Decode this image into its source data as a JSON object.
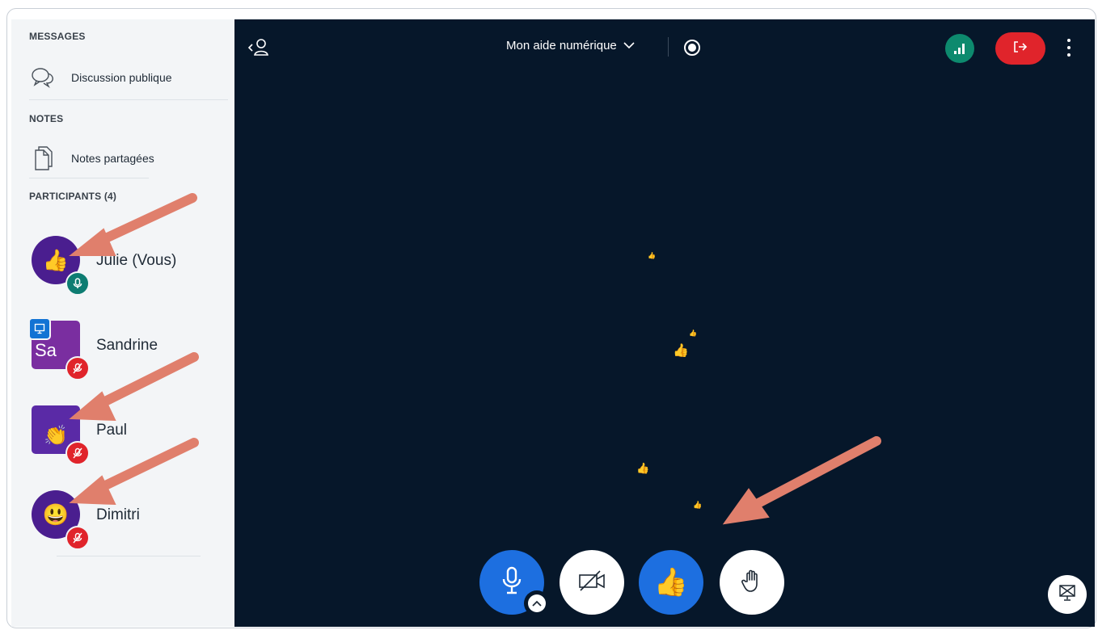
{
  "sidebar": {
    "messages_title": "MESSAGES",
    "public_chat_label": "Discussion publique",
    "notes_title": "NOTES",
    "shared_notes_label": "Notes partagées",
    "participants_title": "PARTICIPANTS (4)",
    "participants": [
      {
        "name": "Julie (Vous)",
        "avatar_emoji": "👍",
        "avatar_color": "#4a1e8f",
        "shape": "round",
        "mic_state": "unmuted",
        "mic_color": "#0d7c72"
      },
      {
        "name": "Sandrine",
        "avatar_text": "Sa",
        "avatar_color": "#7a2ea0",
        "shape": "square",
        "presenter": true,
        "mic_state": "muted",
        "mic_color": "#e0242b"
      },
      {
        "name": "Paul",
        "avatar_emoji": "👏",
        "avatar_color": "#5a2aa6",
        "shape": "square",
        "mic_state": "muted",
        "mic_color": "#e0242b"
      },
      {
        "name": "Dimitri",
        "avatar_emoji": "😃",
        "avatar_color": "#4a1e8f",
        "shape": "round",
        "mic_state": "muted",
        "mic_color": "#e0242b"
      }
    ]
  },
  "topbar": {
    "meeting_title": "Mon aide numérique",
    "icons": [
      "user-list-toggle-icon",
      "chevron-down-icon",
      "record-icon",
      "connection-status-icon",
      "leave-meeting-icon",
      "more-options-icon"
    ],
    "connection_color": "#0d8a6e",
    "leave_color": "#e0242b"
  },
  "controls": {
    "mic_color": "#1d6fe0",
    "reaction_emoji": "👍",
    "icons": [
      "microphone-icon",
      "chevron-up-icon",
      "camera-off-icon",
      "thumbs-up-icon",
      "raise-hand-icon",
      "presentation-icon"
    ]
  },
  "colors": {
    "main_bg": "#06172a",
    "sidebar_bg": "#f3f5f7",
    "annotation_arrow": "#e07f6c"
  }
}
